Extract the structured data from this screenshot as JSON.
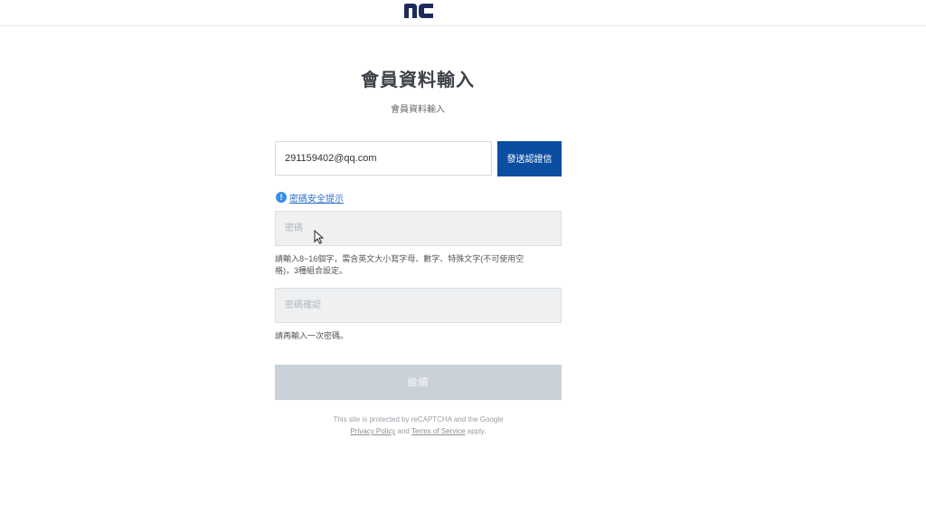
{
  "header": {
    "logo_text": "nc",
    "logo_color": "#1e2a5a"
  },
  "page": {
    "title": "會員資料輸入",
    "subtitle": "會員資料輸入"
  },
  "email": {
    "value": "291159402@qq.com",
    "send_button": "發送認證信"
  },
  "password_hint": {
    "label": "密碼安全提示",
    "icon": "info-icon"
  },
  "password": {
    "placeholder": "密碼",
    "helper_line1": "請輸入8~16個字，需含英文大小寫字母、數字、特殊文字(不可使用空",
    "helper_line2": "格)，3種組合設定。"
  },
  "password_confirm": {
    "placeholder": "密碼確認",
    "helper": "請再輸入一次密碼。"
  },
  "continue_button": "繼續",
  "recaptcha": {
    "line1": "This site is protected by reCAPTCHA and the Google",
    "privacy": "Privacy Policy",
    "and": "and",
    "terms": "Terms of Service",
    "apply": "apply."
  },
  "colors": {
    "primary": "#0a4ea1",
    "disabled": "#cbd1d8",
    "link": "#2f73c9"
  }
}
